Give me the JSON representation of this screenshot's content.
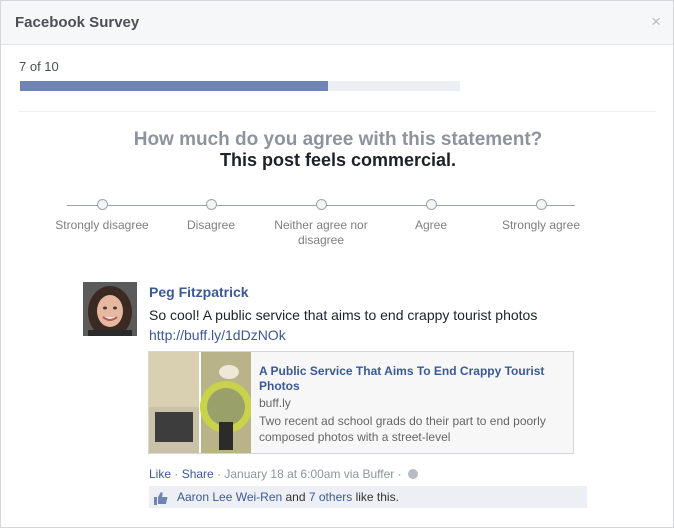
{
  "dialog": {
    "title": "Facebook Survey",
    "close_glyph": "×"
  },
  "progress": {
    "label": "7 of 10",
    "fraction": 0.7
  },
  "question": {
    "prompt": "How much do you agree with this statement?",
    "statement": "This post feels commercial."
  },
  "scale": {
    "options": [
      {
        "label": "Strongly disagree"
      },
      {
        "label": "Disagree"
      },
      {
        "label": "Neither agree nor disagree"
      },
      {
        "label": "Agree"
      },
      {
        "label": "Strongly agree"
      }
    ]
  },
  "post": {
    "author": "Peg Fitzpatrick",
    "text": "So cool! A public service that aims to end crappy tourist photos ",
    "link_text": "http://buff.ly/1dDzNOk",
    "card": {
      "title": "A Public Service That Aims To End Crappy Tourist Photos",
      "domain": "buff.ly",
      "description": "Two recent ad school grads do their part to end poorly composed photos with a street-level"
    },
    "actions": {
      "like": "Like",
      "separator": " · ",
      "share": "Share",
      "timestamp": " · January 18 at 6:00am via Buffer · "
    },
    "likes": {
      "first_name": "Aaron Lee Wei-Ren",
      "and": " and ",
      "others": "7 others",
      "suffix": " like this."
    }
  },
  "icons": {
    "close": "close-icon",
    "globe": "globe-icon",
    "like": "thumbs-up-icon"
  },
  "colors": {
    "accent": "#3b5998",
    "progress_fill": "#6d84b4"
  }
}
